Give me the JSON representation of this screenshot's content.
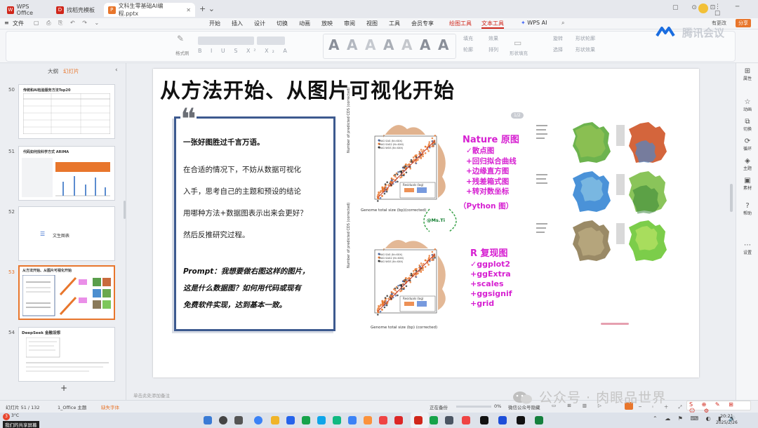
{
  "tabs": [
    {
      "label": "WPS Office"
    },
    {
      "label": "找稻壳模板"
    },
    {
      "label": "文科生零基础AI编程.pptx"
    }
  ],
  "menu": {
    "file": "文件",
    "items": [
      "开始",
      "插入",
      "设计",
      "切换",
      "动画",
      "放映",
      "审阅",
      "视图",
      "工具",
      "会员专享",
      "绘图工具",
      "文本工具",
      "WPS AI"
    ]
  },
  "titlebar": {
    "share": "分享",
    "collab": "有更改"
  },
  "ribbon": {
    "format_painter": "格式刷",
    "fill": "填充",
    "outline": "轮廓",
    "effect": "效果",
    "arrange": "排列",
    "rotate": "旋转",
    "select": "选择",
    "shape_fill": "形状填充",
    "shape_outline": "形状轮廓",
    "shape_effect": "形状效果"
  },
  "watermark_top": "腾讯会议",
  "sidebar": {
    "tab_outline": "大纲",
    "tab_slides": "幻灯片",
    "add": "+",
    "slides": [
      {
        "num": "50",
        "title": "传统和AI检验服务方法Top20"
      },
      {
        "num": "51",
        "title": "代码如何找科学方式 ARIMA"
      },
      {
        "num": "52",
        "title": "文生图表"
      },
      {
        "num": "53",
        "title": "从方法开始、从图片可视化开始"
      },
      {
        "num": "54",
        "title": "DeepSeek 金融设想"
      }
    ]
  },
  "rightbar": [
    "属性",
    "动画",
    "切换",
    "循环",
    "主题",
    "素材",
    "帮助",
    "设置"
  ],
  "slide": {
    "title": "从方法开始、从图片可视化开始",
    "quote": "❝",
    "para1_bold": "一张好图胜过千言万语。",
    "para1_lines": [
      "在合适的情况下，不妨从数据可视化",
      "入手，思考自己的主题和预设的结论",
      "用哪种方法+数据图表示出来会更好？",
      "然后反推研究过程。"
    ],
    "prompt_lines": [
      "Prompt：我想要做右图这样的图片，",
      "这是什么数据图？如何用代码或现有",
      "免费软件实现，达到基本一致。"
    ],
    "page_badge": "1/2",
    "nature_title": "Nature 原图",
    "nature_items": [
      "✓散点图",
      "+回归拟合曲线",
      "+边缘直方图",
      "+残差箱式图",
      "+转对数坐标"
    ],
    "python_label": "（Python 图）",
    "r_title": "R 复现图",
    "r_items": [
      "✓ggplot2",
      "+ggExtra",
      "+scales",
      "+ggsignif",
      "+grid"
    ],
    "plot_top_xlabel": "Genome total size (bp)(corrected)",
    "plot_bottom_xlabel": "Genome total size (bp) (corrected)",
    "plot_ylabel": "Number of predicted CDS (corrected)",
    "legend_items": [
      "MAG SAG (N=XXX)",
      "MAG SAG2 (N=XXX)",
      "MAG WGS (N=XXX)"
    ],
    "residuals_label": "Residuals (log)",
    "handle": "@Ms.Ti"
  },
  "status": {
    "slide_counter": "幻灯片 51 / 132",
    "theme": "1_Office 主题",
    "missing_font": "缺失字体",
    "notes_placeholder": "单击此处添加备注",
    "backup": "正在备份",
    "zoom": "0%",
    "smart": "微信公众号隐藏"
  },
  "watermark_bottom": "公众号 · 肉眼品世界",
  "taskbar": {
    "time": "20:21",
    "date": "2025/2/26",
    "sharing": "我们的共享屏幕",
    "temp": "3°C"
  },
  "colors": {
    "accent_orange": "#e8762c",
    "slide_border": "#3d5a8f",
    "magenta": "#d61fd1",
    "wps_red": "#d0261a"
  }
}
